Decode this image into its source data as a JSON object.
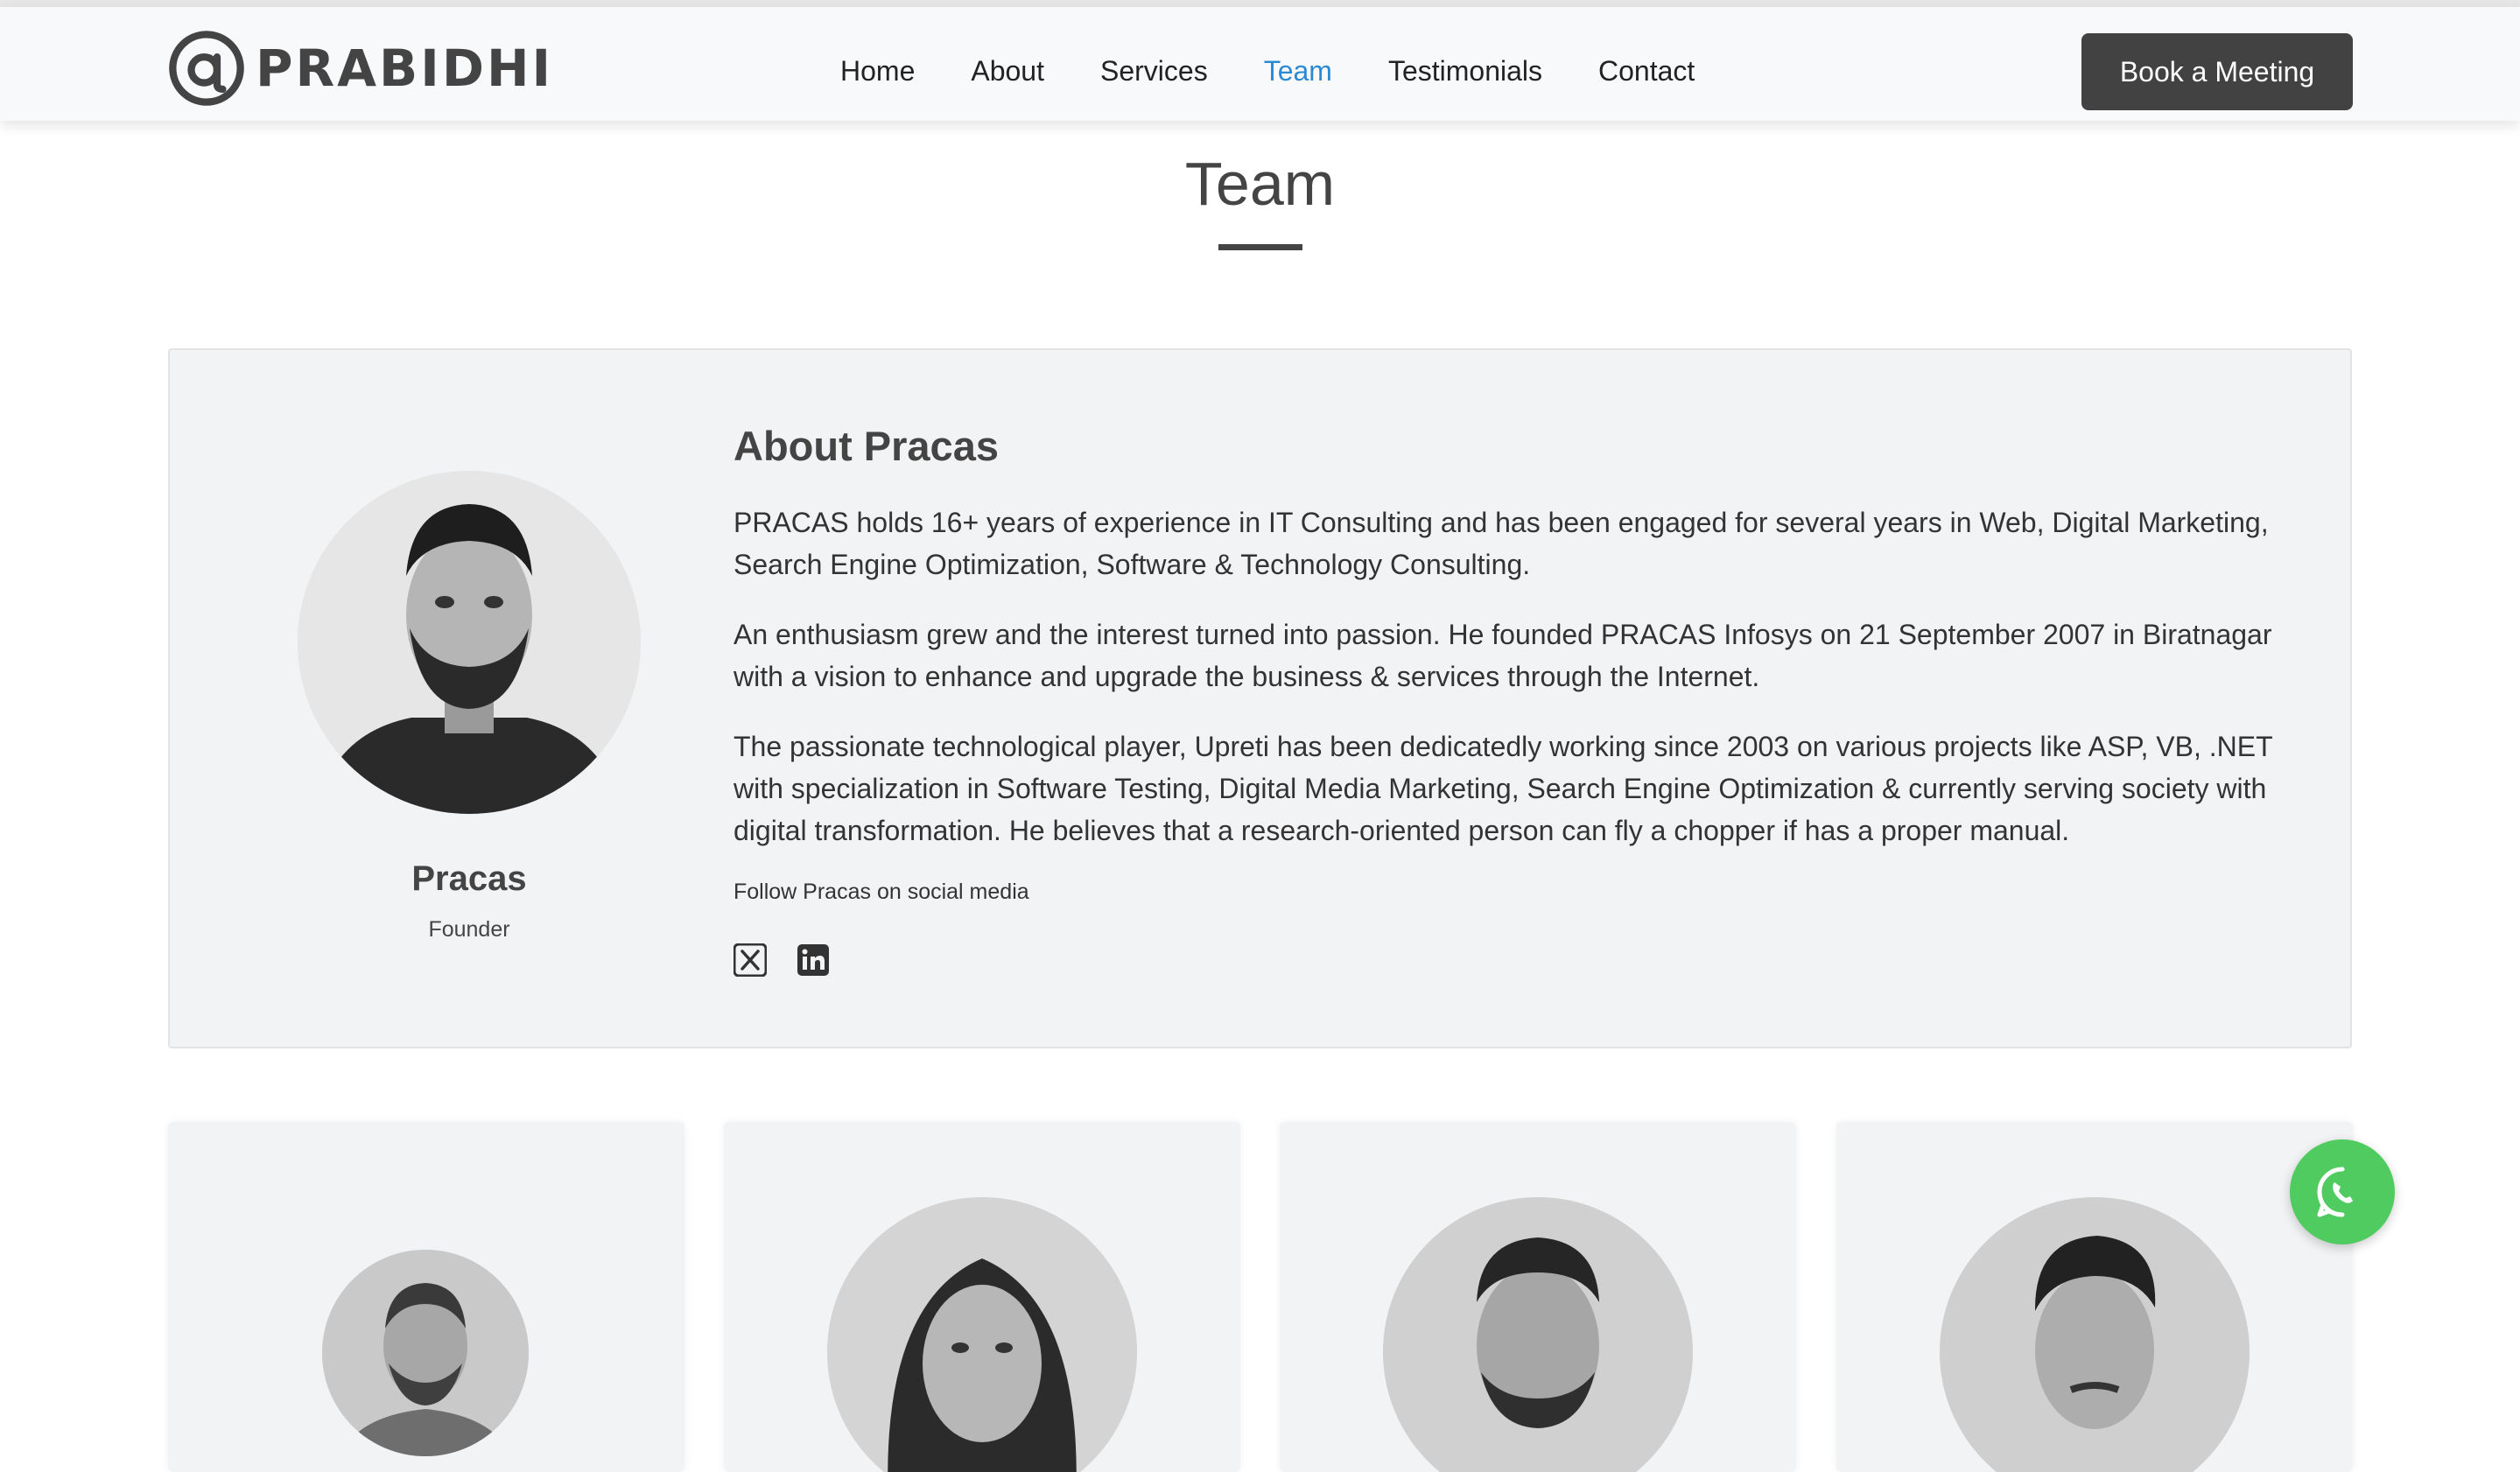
{
  "brand": {
    "name": "PRABIDHI"
  },
  "nav": {
    "items": [
      {
        "label": "Home",
        "active": false
      },
      {
        "label": "About",
        "active": false
      },
      {
        "label": "Services",
        "active": false
      },
      {
        "label": "Team",
        "active": true
      },
      {
        "label": "Testimonials",
        "active": false
      },
      {
        "label": "Contact",
        "active": false
      }
    ],
    "cta_label": "Book a Meeting"
  },
  "section": {
    "title": "Team"
  },
  "founder": {
    "name": "Pracas",
    "role": "Founder",
    "about_heading": "About Pracas",
    "paragraphs": [
      "PRACAS holds 16+ years of experience in IT Consulting and has been engaged for several years in Web, Digital Marketing, Search Engine Optimization, Software & Technology Consulting.",
      "An enthusiasm grew and the interest turned into passion. He founded PRACAS Infosys on 21 September 2007 in Biratnagar with a vision to enhance and upgrade the business & services through the Internet.",
      "The passionate technological player, Upreti has been dedicatedly working since 2003 on various projects like ASP, VB, .NET with specialization in Software Testing, Digital Media Marketing, Search Engine Optimization & currently serving society with digital transformation. He believes that a research-oriented person can fly a chopper if has a proper manual."
    ],
    "follow_text": "Follow Pracas on social media",
    "socials": [
      "x-icon",
      "linkedin-icon"
    ]
  },
  "team_members": [
    {
      "photo": "member-photo-1"
    },
    {
      "photo": "member-photo-2"
    },
    {
      "photo": "member-photo-3"
    },
    {
      "photo": "member-photo-4"
    }
  ],
  "floating": {
    "icon": "whatsapp-icon"
  },
  "colors": {
    "accent": "#2b8ad2",
    "button": "#424242",
    "card_bg": "#f2f3f4",
    "whatsapp": "#4fcb5f"
  }
}
